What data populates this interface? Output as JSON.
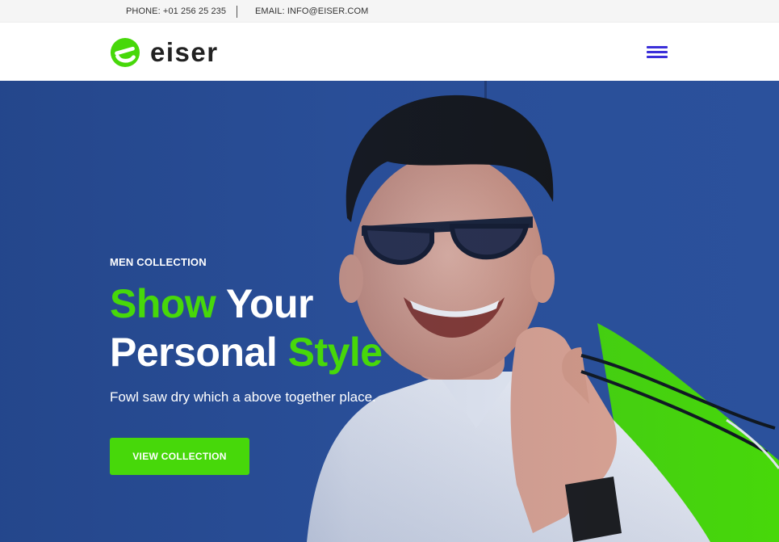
{
  "topbar": {
    "phone": "PHONE: +01 256 25 235",
    "email": "EMAIL: INFO@EISER.COM"
  },
  "header": {
    "logo_text": "eiser",
    "menu_icon": "hamburger-menu-icon",
    "menu_color": "#3b2fd9"
  },
  "hero": {
    "eyebrow": "MEN COLLECTION",
    "headline_line1_accent": "Show",
    "headline_line1_rest": " Your",
    "headline_line2_rest": "Personal ",
    "headline_line2_accent": "Style",
    "subtitle": "Fowl saw dry which a above together place.",
    "cta_label": "VIEW COLLECTION",
    "accent_color": "#47d80a",
    "background_color": "#2a4f9a"
  }
}
